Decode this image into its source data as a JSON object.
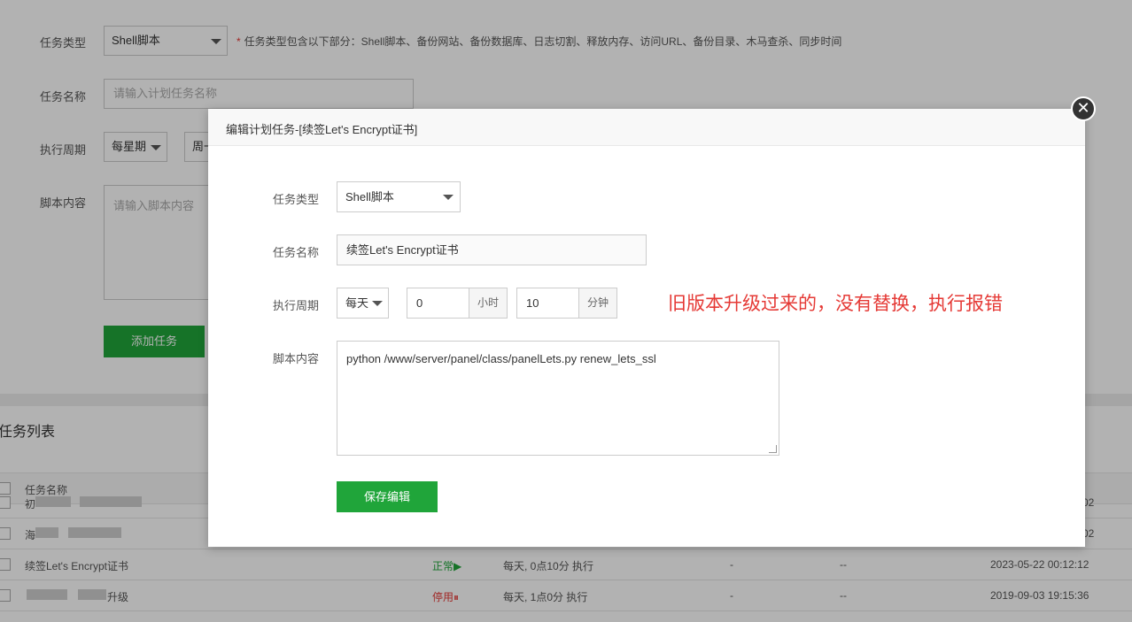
{
  "form": {
    "task_type_label": "任务类型",
    "task_type_value": "Shell脚本",
    "task_type_hint_star": "*",
    "task_type_hint": "任务类型包含以下部分：Shell脚本、备份网站、备份数据库、日志切割、释放内存、访问URL、备份目录、木马查杀、同步时间",
    "task_name_label": "任务名称",
    "task_name_placeholder": "请输入计划任务名称",
    "period_label": "执行周期",
    "period_value": "每星期",
    "weekday_value": "周一",
    "script_label": "脚本内容",
    "script_placeholder": "请输入脚本内容",
    "add_button": "添加任务"
  },
  "task_list": {
    "title": "任务列表",
    "header_name": "任务名称",
    "rows": [
      {
        "name_visible": "初",
        "date_tail": "02"
      },
      {
        "name_visible": "海",
        "date_tail": "02"
      },
      {
        "name": "续签Let's Encrypt证书",
        "status": "正常",
        "status_icon": "▶",
        "period": "每天, 0点10分 执行",
        "col4": "-",
        "col5": "--",
        "date": "2023-05-22 00:12:12"
      },
      {
        "name_visible": "升级",
        "status": "停用",
        "status_icon": "⏸",
        "period": "每天, 1点0分 执行",
        "col4": "-",
        "col5": "--",
        "date": "2019-09-03 19:15:36"
      }
    ]
  },
  "modal": {
    "title": "编辑计划任务-[续签Let's Encrypt证书]",
    "close_glyph": "✕",
    "task_type_label": "任务类型",
    "task_type_value": "Shell脚本",
    "task_name_label": "任务名称",
    "task_name_value": "续签Let's Encrypt证书",
    "period_label": "执行周期",
    "period_value": "每天",
    "hour_value": "0",
    "hour_unit": "小时",
    "minute_value": "10",
    "minute_unit": "分钟",
    "script_label": "脚本内容",
    "script_value": "python /www/server/panel/class/panelLets.py renew_lets_ssl",
    "save_button": "保存编辑"
  },
  "annotation": "旧版本升级过来的，没有替换，执行报错",
  "colors": {
    "primary_green": "#20a53a",
    "danger_red": "#e53935",
    "overlay": "rgba(0,0,0,0.30)"
  }
}
